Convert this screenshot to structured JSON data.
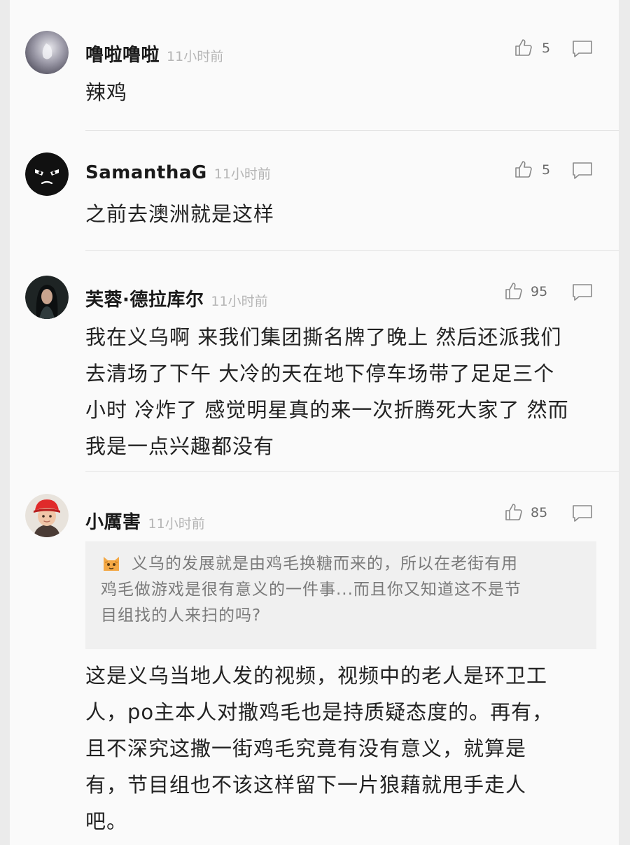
{
  "comments": [
    {
      "author": "噜啦噜啦",
      "time": "11小时前",
      "likes": "5",
      "text": "辣鸡",
      "avatar": "grey-round-avatar-icon"
    },
    {
      "author": "SamanthaG",
      "time": "11小时前",
      "likes": "5",
      "text": "之前去澳洲就是这样",
      "avatar": "black-angry-face-avatar-icon"
    },
    {
      "author": "芙蓉·德拉库尔",
      "time": "11小时前",
      "likes": "95",
      "text_lines": [
        "我在义乌啊 来我们集团撕名牌了晚上 然后还派我们",
        "去清场了下午 大冷的天在地下停车场带了足足三个",
        "小时 冷炸了 感觉明星真的来一次折腾死大家了 然而",
        "我是一点兴趣都没有"
      ],
      "avatar": "dark-haired-person-avatar-icon"
    },
    {
      "author": "小厲害",
      "time": "11小时前",
      "likes": "85",
      "quote_lines": [
        "义乌的发展就是由鸡毛换糖而来的，所以在老街有用",
        "鸡毛做游戏是很有意义的一件事...而且你又知道这不是节",
        "目组找的人来扫的吗?"
      ],
      "quote_emoji": "cat-face-icon",
      "text_lines": [
        "这是义乌当地人发的视频，视频中的老人是环卫工",
        "人，po主本人对撒鸡毛也是持质疑态度的。再有，",
        "且不深究这撒一街鸡毛究竟有没有意义，就算是",
        "有，节目组也不该这样留下一片狼藉就甩手走人",
        "吧。"
      ],
      "avatar": "child-red-cap-avatar-icon"
    }
  ],
  "icons": {
    "like": "thumbs-up-icon",
    "reply": "comment-bubble-icon"
  },
  "colors": {
    "background": "#fafafa",
    "page": "#ebebeb",
    "author": "#1a1a1a",
    "time": "#b5b5b5",
    "text": "#222222",
    "quote_bg": "#f0f0f0",
    "quote_text": "#7a7a7a"
  }
}
